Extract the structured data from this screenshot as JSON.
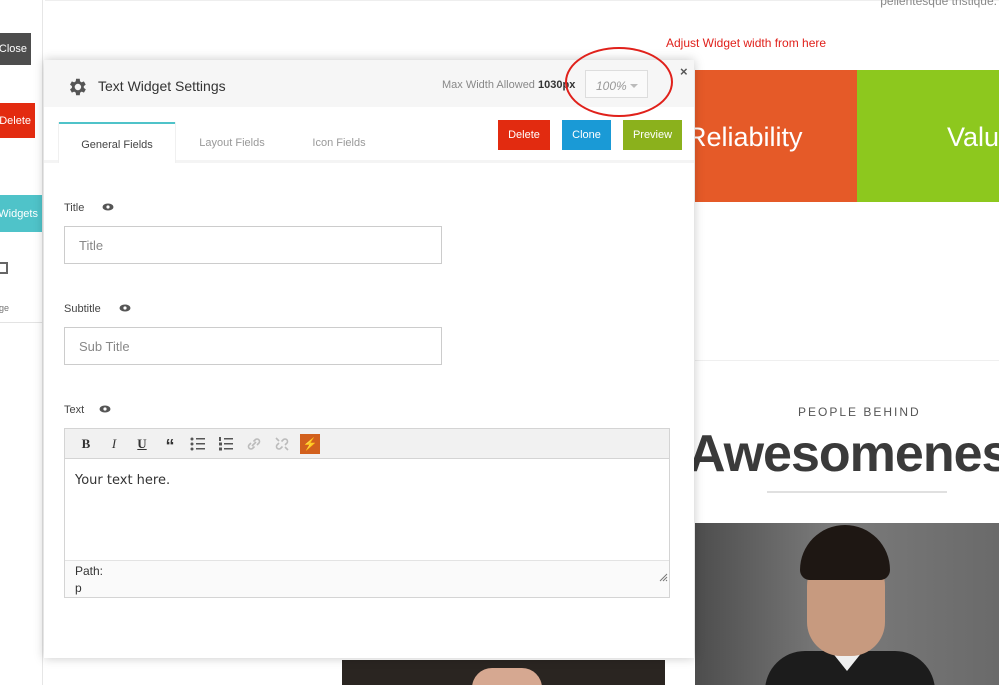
{
  "left_sidebar": {
    "close_label": "Close",
    "delete_label": "Delete",
    "widgets_label": "Widgets",
    "page_label": "Page"
  },
  "background": {
    "corner_text": "pellentesque tristique.",
    "annotation": "Adjust Widget width from here",
    "tile_orange_text": "Reliability",
    "tile_green_text": "Value",
    "kicker": "PEOPLE BEHIND",
    "headline": "Awesomeness",
    "colors": {
      "orange": "#e55a28",
      "green": "#8dc81e",
      "annotation_red": "#e0211b"
    }
  },
  "modal": {
    "title": "Text Widget Settings",
    "title_icon": "gear-icon",
    "max_width_label": "Max Width Allowed",
    "max_width_value": "1030px",
    "width_select_value": "100%",
    "close_glyph": "×",
    "tabs": [
      {
        "label": "General Fields",
        "active": true
      },
      {
        "label": "Layout Fields",
        "active": false
      },
      {
        "label": "Icon Fields",
        "active": false
      }
    ],
    "buttons": {
      "delete": "Delete",
      "clone": "Clone",
      "preview": "Preview"
    },
    "fields": {
      "title": {
        "label": "Title",
        "placeholder": "Title"
      },
      "subtitle": {
        "label": "Subtitle",
        "placeholder": "Sub Title"
      },
      "text": {
        "label": "Text",
        "content": "Your text here.",
        "path_label": "Path:",
        "path_value": "p"
      }
    },
    "toolbar": {
      "bold": "B",
      "italic": "I",
      "underline": "U",
      "quote": "“",
      "bolt": "⚡"
    }
  }
}
